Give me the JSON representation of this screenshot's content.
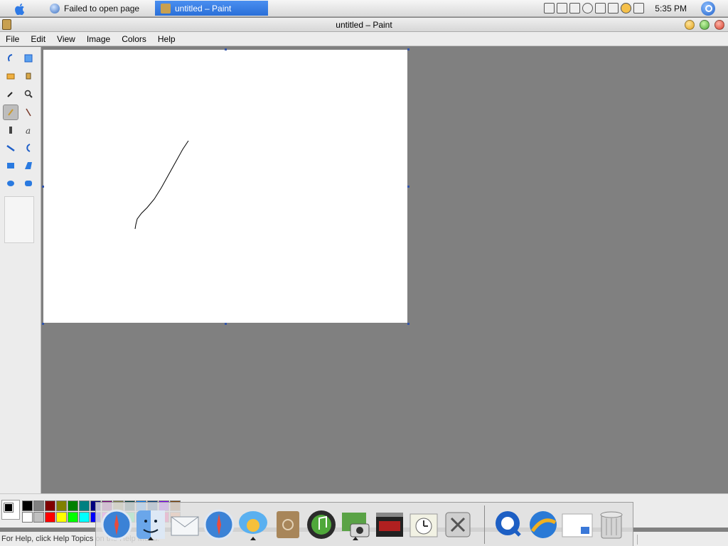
{
  "taskbar": {
    "tasks": [
      {
        "label": "Failed to open page"
      },
      {
        "label": "untitled – Paint"
      }
    ],
    "clock": "5:35 PM"
  },
  "window": {
    "title": "untitled – Paint"
  },
  "menu": {
    "items": [
      "File",
      "Edit",
      "View",
      "Image",
      "Colors",
      "Help"
    ]
  },
  "toolbox": {
    "tools": [
      "free-select",
      "rect-select",
      "eraser",
      "fill",
      "color-picker",
      "magnifier",
      "pencil",
      "brush",
      "airbrush",
      "text",
      "line",
      "curve",
      "rectangle",
      "polygon",
      "ellipse",
      "rounded-rect"
    ],
    "selected_tool": "pencil"
  },
  "palette": {
    "foreground": "#000000",
    "background": "#ffffff",
    "colors": [
      "#000000",
      "#808080",
      "#800000",
      "#808000",
      "#008000",
      "#008080",
      "#000080",
      "#800080",
      "#808040",
      "#004040",
      "#0080ff",
      "#004080",
      "#8000ff",
      "#804000",
      "#ffffff",
      "#c0c0c0",
      "#ff0000",
      "#ffff00",
      "#00ff00",
      "#00ffff",
      "#0000ff",
      "#ff00ff",
      "#ffff80",
      "#00ff80",
      "#80ffff",
      "#8080ff",
      "#ff0080",
      "#ff8040"
    ]
  },
  "dock": {
    "apps": [
      "Safari",
      "Finder",
      "Mail",
      "Safari",
      "iChat",
      "Address Book",
      "iTunes",
      "iPhoto",
      "Front Row",
      "Time Machine",
      "System Preferences",
      "QuickTime",
      "Network",
      "Preview",
      "Trash"
    ]
  },
  "status": {
    "message": "For Help, click Help Topics on the Help Menu."
  }
}
